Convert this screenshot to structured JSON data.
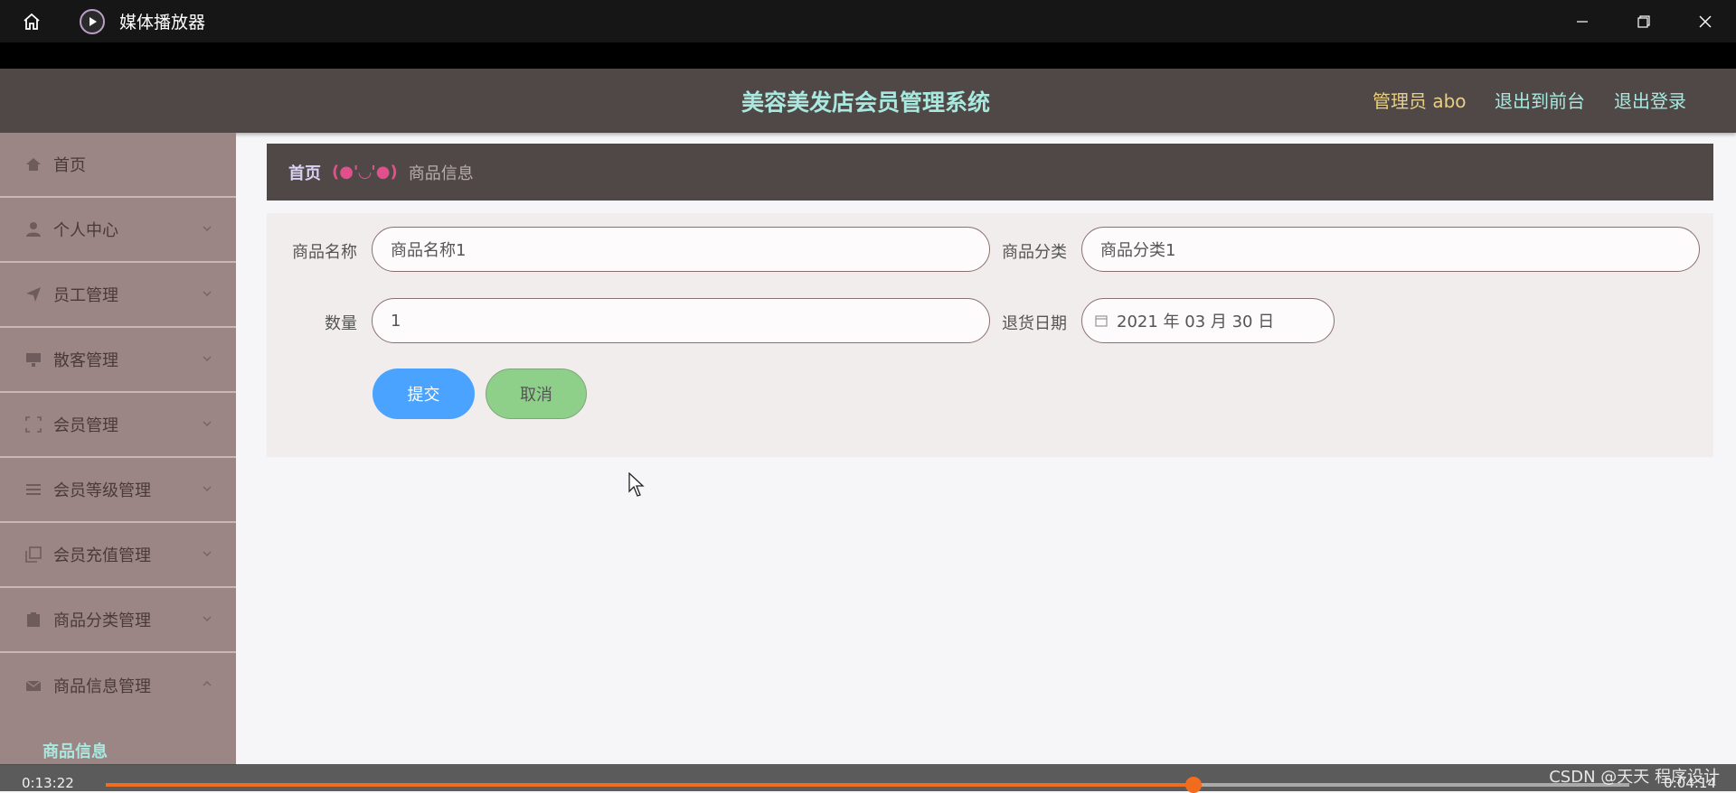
{
  "player": {
    "title": "媒体播放器",
    "icons": [
      "home-icon",
      "play-icon",
      "minimize-icon",
      "restore-icon",
      "close-icon"
    ],
    "time_elapsed": "0:13:22",
    "time_remaining": "0:04:14",
    "progress": 0.714,
    "watermark": "CSDN @天天 程序设计"
  },
  "header": {
    "title": "美容美发店会员管理系统",
    "admin": "管理员 abo",
    "links": [
      "退出到前台",
      "退出登录"
    ]
  },
  "sidebar": {
    "items": [
      {
        "label": "首页",
        "icon": "home-icon",
        "chevron": false
      },
      {
        "label": "个人中心",
        "icon": "user-icon",
        "chevron": true
      },
      {
        "label": "员工管理",
        "icon": "send-icon",
        "chevron": true
      },
      {
        "label": "散客管理",
        "icon": "monitor-icon",
        "chevron": true
      },
      {
        "label": "会员管理",
        "icon": "frame-icon",
        "chevron": true
      },
      {
        "label": "会员等级管理",
        "icon": "list-icon",
        "chevron": true
      },
      {
        "label": "会员充值管理",
        "icon": "copy-icon",
        "chevron": true
      },
      {
        "label": "商品分类管理",
        "icon": "clipboard-icon",
        "chevron": true
      },
      {
        "label": "商品信息管理",
        "icon": "mail-icon",
        "chevron": true,
        "expanded": true
      }
    ],
    "sub_item": "商品信息"
  },
  "breadcrumb": {
    "home": "首页",
    "separator": "(●'◡'●)",
    "current": "商品信息"
  },
  "form": {
    "name_label": "商品名称",
    "name_value": "商品名称1",
    "category_label": "商品分类",
    "category_value": "商品分类1",
    "quantity_label": "数量",
    "quantity_value": "1",
    "return_date_label": "退货日期",
    "return_date_value": "2021 年 03 月 30 日",
    "submit": "提交",
    "cancel": "取消"
  },
  "colors": {
    "header_bg": "#4f4847",
    "accent_text": "#a8e8de",
    "admin_text": "#e9cf83",
    "sidebar_bg": "#9b8585",
    "submit_btn": "#4aa3ff",
    "cancel_btn": "#8ed08a",
    "progress": "#f26c1e"
  }
}
